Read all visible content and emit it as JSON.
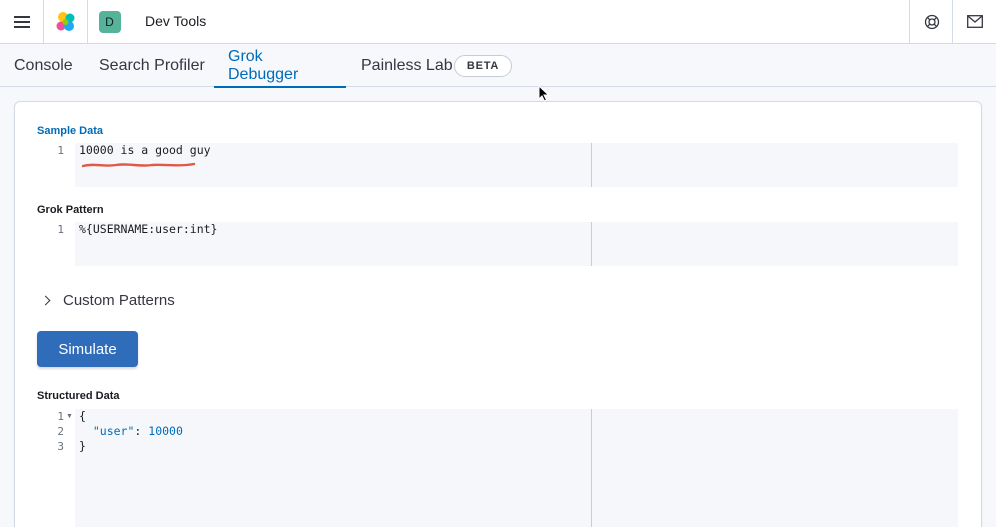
{
  "header": {
    "title": "Dev Tools",
    "space_initial": "D",
    "icons": [
      "menu-icon",
      "elastic-logo",
      "help-icon",
      "mail-icon"
    ]
  },
  "tabs": [
    {
      "label": "Console",
      "active": false
    },
    {
      "label": "Search Profiler",
      "active": false
    },
    {
      "label": "Grok Debugger",
      "active": true
    },
    {
      "label": "Painless Lab",
      "active": false
    }
  ],
  "beta_badge": "BETA",
  "sample_data": {
    "label": "Sample Data",
    "lines": [
      {
        "number": "1",
        "text": "10000 is a good guy"
      }
    ]
  },
  "grok_pattern": {
    "label": "Grok Pattern",
    "lines": [
      {
        "number": "1",
        "text": "%{USERNAME:user:int}"
      }
    ]
  },
  "custom_patterns": {
    "label": "Custom Patterns"
  },
  "simulate_button": {
    "label": "Simulate"
  },
  "structured_data": {
    "label": "Structured Data",
    "lines": [
      {
        "number": "1",
        "open": "{"
      },
      {
        "number": "2",
        "key": "\"user\"",
        "colon": ": ",
        "value": "10000"
      },
      {
        "number": "3",
        "close": "}"
      }
    ]
  },
  "colors": {
    "accent": "#006bb8",
    "button": "#2f6cb9",
    "avatar": "#54b399",
    "annotation": "#e0584a"
  }
}
